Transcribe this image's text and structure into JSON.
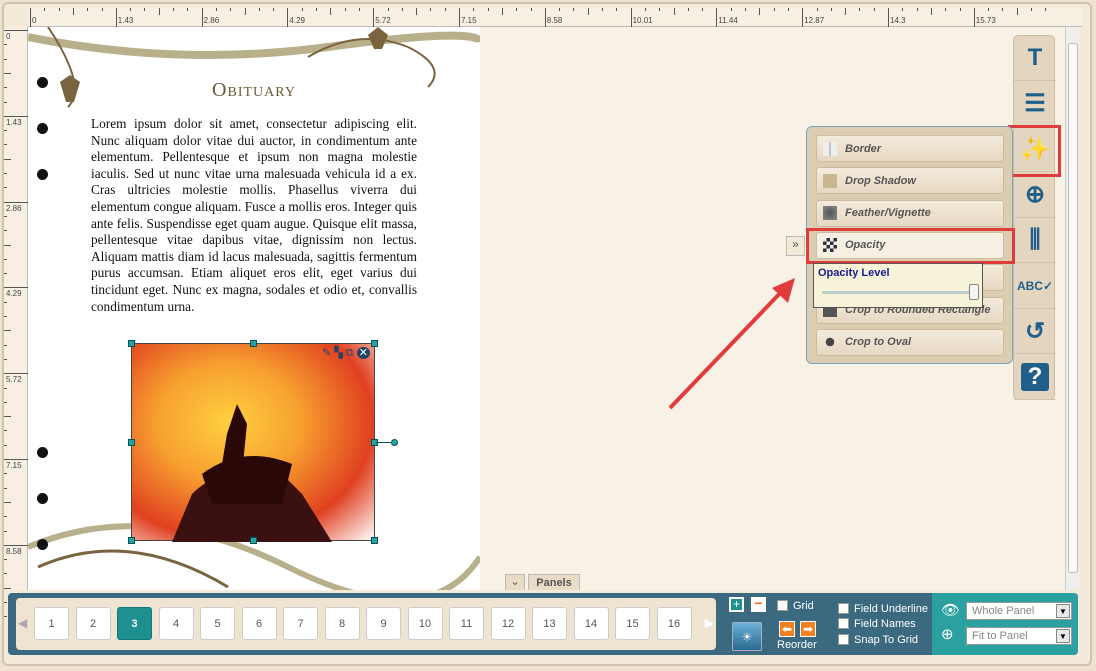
{
  "ruler": {
    "h_labels": [
      "0",
      "1.43",
      "2.86",
      "4.29",
      "5.72",
      "7.15",
      "8.58",
      "10.01",
      "11.44",
      "12.87",
      "14.3",
      "15.73"
    ],
    "v_labels": [
      "0",
      "1.43",
      "2.86",
      "4.29",
      "5.72",
      "7.15",
      "8.58"
    ]
  },
  "document": {
    "title": "Obituary",
    "body": "Lorem ipsum dolor sit amet, consectetur adipiscing elit. Nunc aliquam dolor vitae dui auctor, in condimentum ante elementum. Pellentesque et ipsum non magna molestie iaculis. Sed ut nunc vitae urna malesuada vehicula id a ex. Cras ultricies molestie mollis. Phasellus viverra dui elementum congue aliquam. Fusce a mollis eros. Integer quis ante felis. Suspendisse eget quam augue. Quisque elit massa, pellentesque vitae dapibus vitae, dignissim non lectus. Aliquam mattis diam id lacus malesuada, sagittis fermentum purus accumsan. Etiam aliquet eros elit, eget varius dui tincidunt eget. Nunc ex magna, sodales et odio et, convallis condimentum urna."
  },
  "toolbar": {
    "items": [
      {
        "icon": "text-icon",
        "glyph": "T"
      },
      {
        "icon": "align-icon",
        "glyph": "☰"
      },
      {
        "icon": "magic-wand-icon",
        "glyph": "✨"
      },
      {
        "icon": "add-icon",
        "glyph": "⊕"
      },
      {
        "icon": "distribute-icon",
        "glyph": "⫼"
      },
      {
        "icon": "spellcheck-icon",
        "glyph": "ABC✓"
      },
      {
        "icon": "undo-icon",
        "glyph": "↺"
      },
      {
        "icon": "help-icon",
        "glyph": "?"
      }
    ]
  },
  "effects": {
    "items": [
      "Border",
      "Drop Shadow",
      "Feather/Vignette",
      "Opacity",
      "",
      "Crop to Rounded Rectangle",
      "Crop to Oval"
    ],
    "opacity_label": "Opacity Level",
    "opacity_value": 100
  },
  "panels_label": "Panels",
  "pages": {
    "items": [
      "1",
      "2",
      "3",
      "4",
      "5",
      "6",
      "7",
      "8",
      "9",
      "10",
      "11",
      "12",
      "13",
      "14",
      "15",
      "16"
    ],
    "active": "3"
  },
  "controls": {
    "grid": "Grid",
    "reorder": "Reorder",
    "field_underline": "Field Underline",
    "field_names": "Field Names",
    "snap_to_grid": "Snap To Grid",
    "view_select": "Whole Panel",
    "zoom_select": "Fit to Panel"
  },
  "colors": {
    "accent": "#2aa0a0",
    "bar": "#3b6a80",
    "highlight": "#e03c3c"
  }
}
